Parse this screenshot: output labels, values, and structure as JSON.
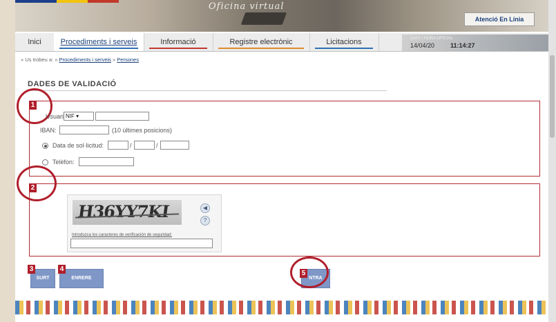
{
  "banner": {
    "watermark": "Oficina virtual",
    "atencio_button": "Atenció En Línia"
  },
  "nav": {
    "tabs": [
      {
        "label": "Inici",
        "accent": "#2d6fb2"
      },
      {
        "label": "Procediments i serveis",
        "accent": "#2d6fb2"
      },
      {
        "label": "Informació",
        "accent": "#c2372f"
      },
      {
        "label": "Registre electrònic",
        "accent": "#e08a2c"
      },
      {
        "label": "Licitacions",
        "accent": "#2d6fb2"
      }
    ],
    "date_label": "DATA I HORA OFICIAL",
    "date": "14/04/20",
    "time": "11:14:27"
  },
  "breadcrumb": {
    "prefix": "» Us trobeu a: »",
    "link1": "Procediments i serveis",
    "sep": "»",
    "link2": "Persones"
  },
  "page_title": "DADES DE VALIDACIÓ",
  "section1": {
    "number": "1",
    "usuari_label": "Usuari:",
    "usuari_type": "NIF ▾",
    "iban_label": "IBAN:",
    "iban_hint": "(10 últimes posicions)",
    "date_option": "Data de sol·licitud:",
    "date_sep1": "/",
    "date_sep2": "/",
    "phone_option": "Telèfon:"
  },
  "section2": {
    "number": "2",
    "captcha_text": "H36YY7KI",
    "captcha_label": "Introduzca los caracteres de verificación de seguridad:",
    "audio_icon": "speaker-icon",
    "help_icon": "question-icon"
  },
  "buttons": {
    "n3": "3",
    "surt": "SURT",
    "n4": "4",
    "enrere": "ENRERE",
    "n5": "5",
    "entra": "NTRA"
  },
  "colors": {
    "accent_red": "#b01e2a",
    "button_blue": "#7f97c7"
  }
}
